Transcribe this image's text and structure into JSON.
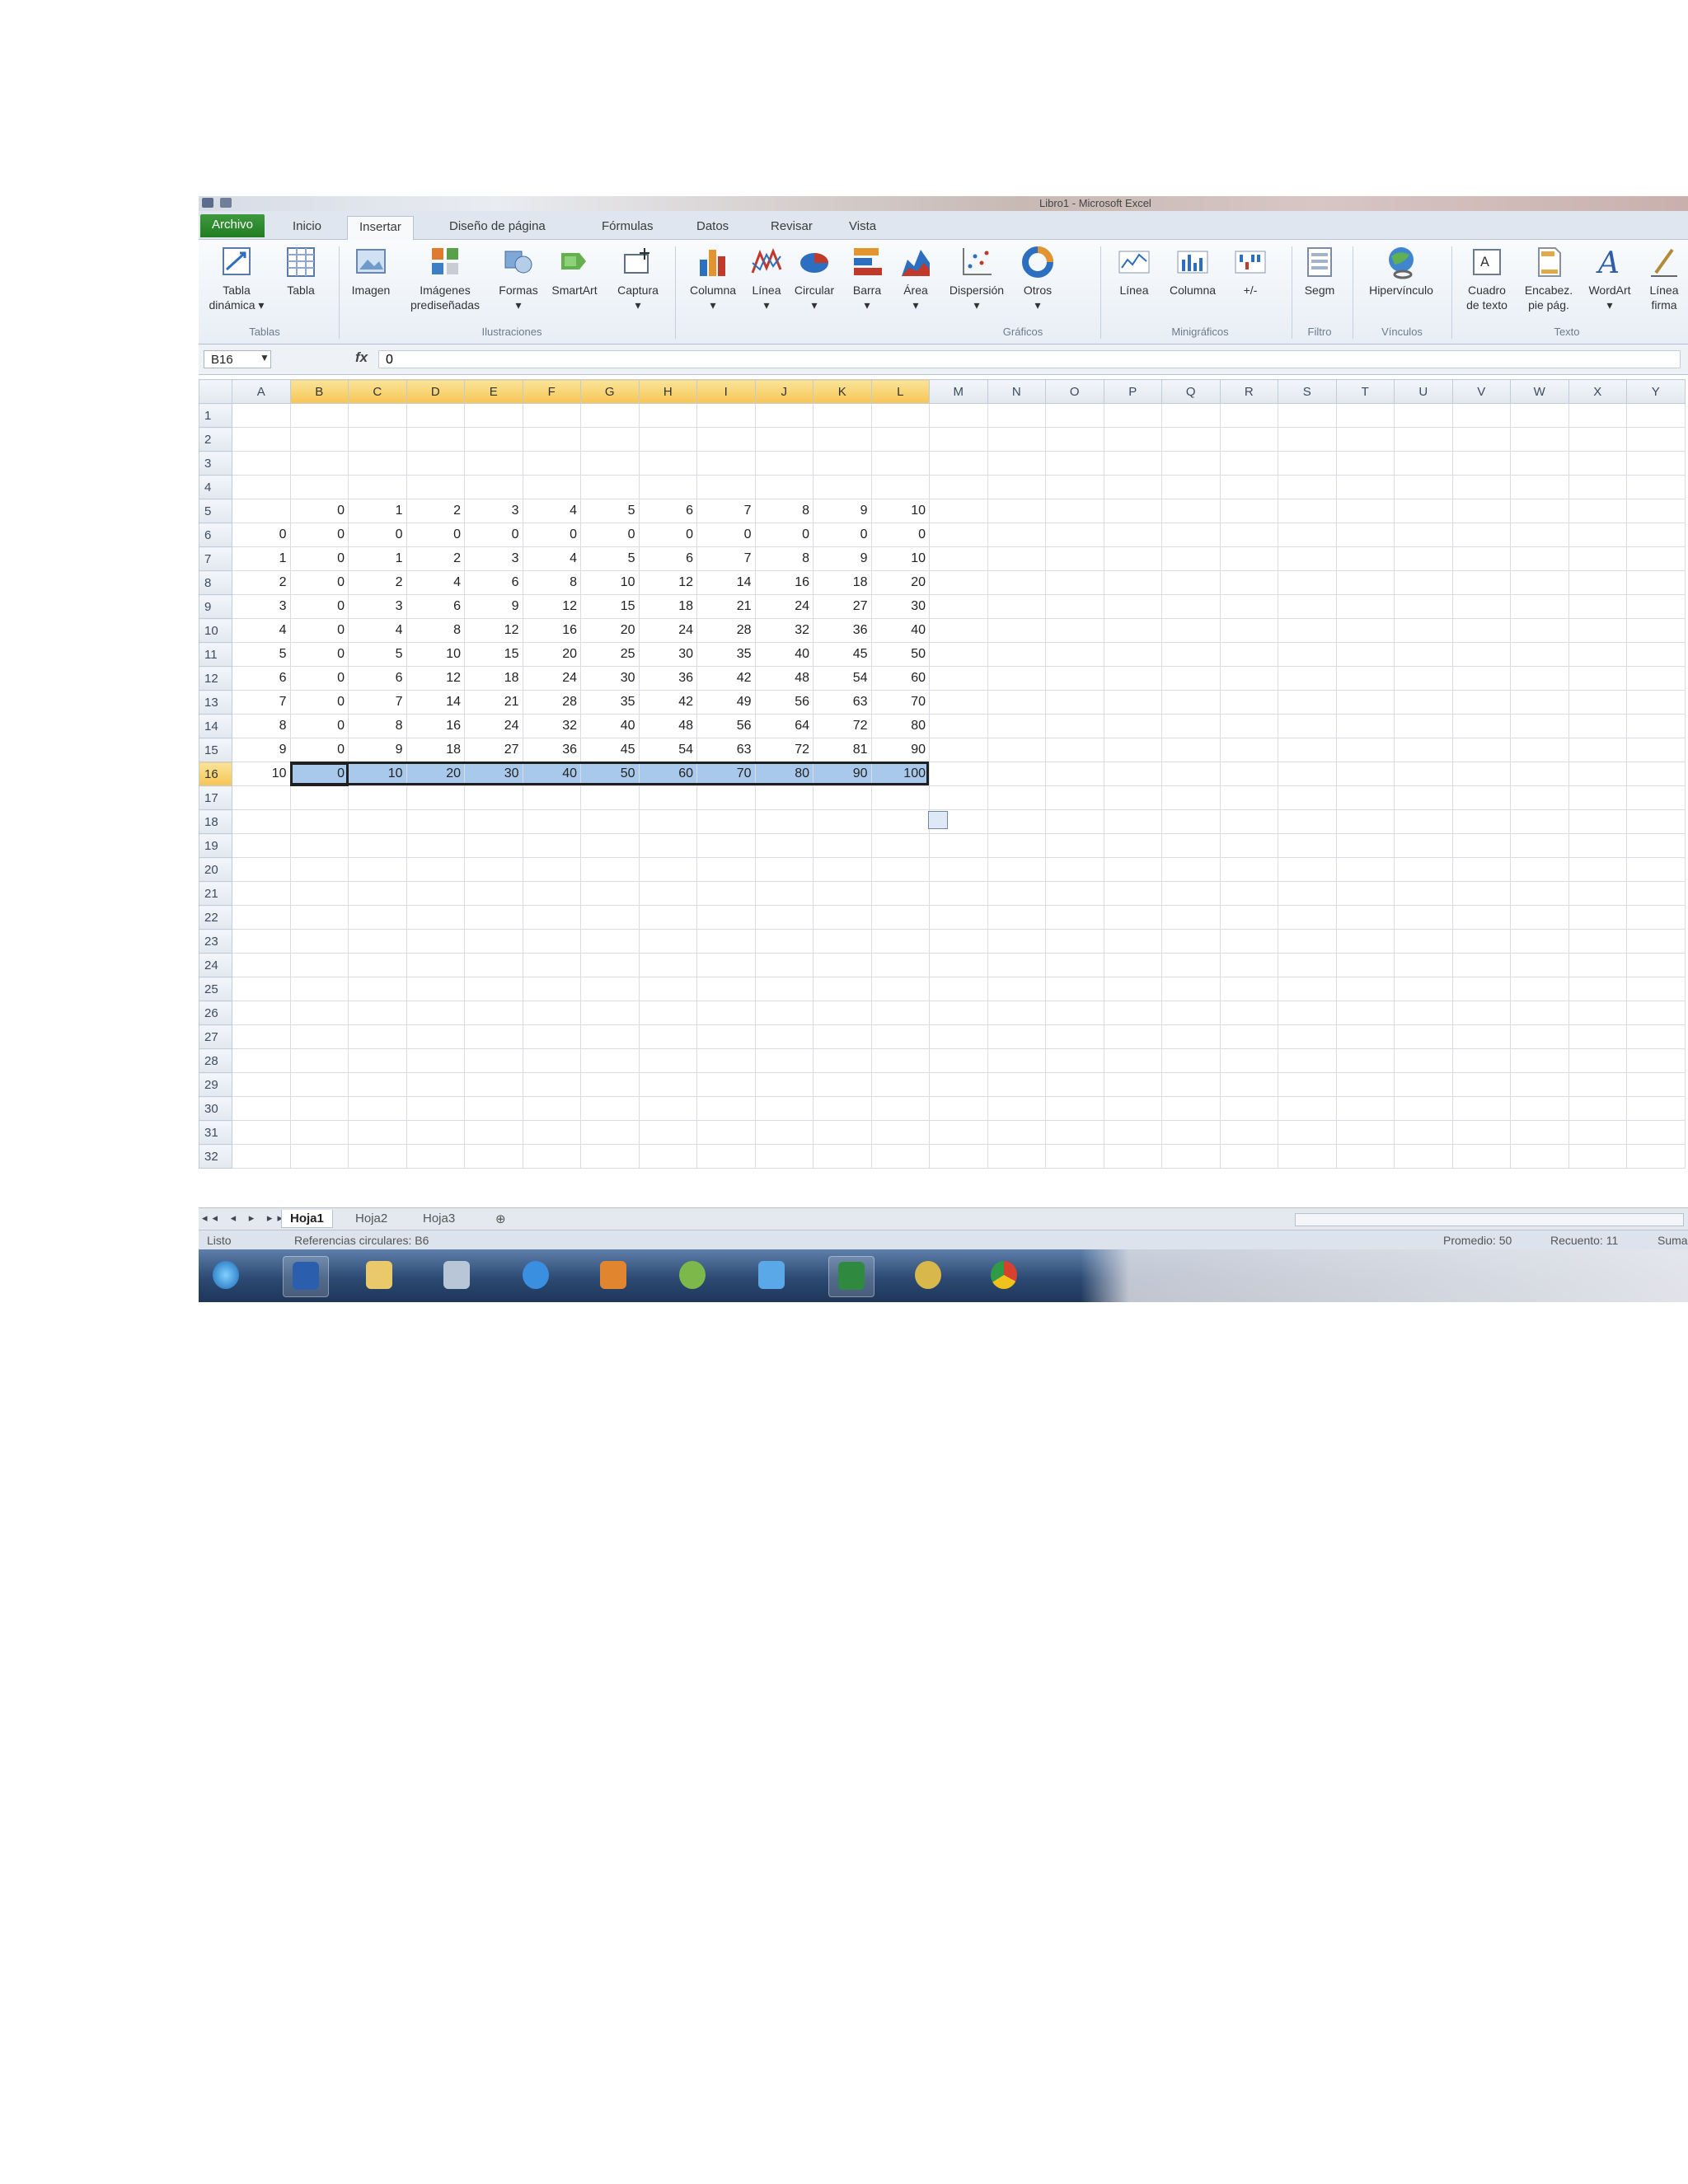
{
  "window": {
    "title": "Libro1 - Microsoft Excel"
  },
  "tabs": [
    "Archivo",
    "Inicio",
    "Insertar",
    "Diseño de página",
    "Fórmulas",
    "Datos",
    "Revisar",
    "Vista"
  ],
  "ribbon": {
    "buttons": {
      "tabla_dinamica": "Tabla\ndinámica ▾",
      "tabla": "Tabla",
      "imagen": "Imagen",
      "imagenes_pred": "Imágenes\nprediseñadas",
      "formas": "Formas\n▾",
      "smartart": "SmartArt",
      "captura": "Captura\n▾",
      "columna": "Columna\n▾",
      "linea": "Línea\n▾",
      "circular": "Circular\n▾",
      "barra": "Barra\n▾",
      "area": "Área\n▾",
      "dispersion": "Dispersión\n▾",
      "otros": "Otros\n▾",
      "mini_linea": "Línea",
      "mini_columna": "Columna",
      "mini_pm": "+/-",
      "segm": "Segm",
      "hipervinculo": "Hipervínculo",
      "cuadro_texto": "Cuadro\nde texto",
      "encabez": "Encabez.\npie pág.",
      "wordart": "WordArt\n▾",
      "linea_firma": "Línea\nfirma"
    },
    "groups": {
      "tablas": "Tablas",
      "ilustraciones": "Ilustraciones",
      "graficos": "Gráficos",
      "minigraficos": "Minigráficos",
      "filtro": "Filtro",
      "vinculos": "Vínculos",
      "texto": "Texto"
    }
  },
  "formula_bar": {
    "name_box": "B16",
    "fx": "fx",
    "value": "0"
  },
  "sheet": {
    "columns": [
      "A",
      "B",
      "C",
      "D",
      "E",
      "F",
      "G",
      "H",
      "I",
      "J",
      "K",
      "L",
      "M",
      "N",
      "O",
      "P",
      "Q",
      "R",
      "S",
      "T",
      "U",
      "V",
      "W",
      "X",
      "Y"
    ],
    "row_count": 32,
    "rows": {
      "5": [
        "",
        "0",
        "1",
        "2",
        "3",
        "4",
        "5",
        "6",
        "7",
        "8",
        "9",
        "10"
      ],
      "6": [
        "0",
        "0",
        "0",
        "0",
        "0",
        "0",
        "0",
        "0",
        "0",
        "0",
        "0",
        "0"
      ],
      "7": [
        "1",
        "0",
        "1",
        "2",
        "3",
        "4",
        "5",
        "6",
        "7",
        "8",
        "9",
        "10"
      ],
      "8": [
        "2",
        "0",
        "2",
        "4",
        "6",
        "8",
        "10",
        "12",
        "14",
        "16",
        "18",
        "20"
      ],
      "9": [
        "3",
        "0",
        "3",
        "6",
        "9",
        "12",
        "15",
        "18",
        "21",
        "24",
        "27",
        "30"
      ],
      "10": [
        "4",
        "0",
        "4",
        "8",
        "12",
        "16",
        "20",
        "24",
        "28",
        "32",
        "36",
        "40"
      ],
      "11": [
        "5",
        "0",
        "5",
        "10",
        "15",
        "20",
        "25",
        "30",
        "35",
        "40",
        "45",
        "50"
      ],
      "12": [
        "6",
        "0",
        "6",
        "12",
        "18",
        "24",
        "30",
        "36",
        "42",
        "48",
        "54",
        "60"
      ],
      "13": [
        "7",
        "0",
        "7",
        "14",
        "21",
        "28",
        "35",
        "42",
        "49",
        "56",
        "63",
        "70"
      ],
      "14": [
        "8",
        "0",
        "8",
        "16",
        "24",
        "32",
        "40",
        "48",
        "56",
        "64",
        "72",
        "80"
      ],
      "15": [
        "9",
        "0",
        "9",
        "18",
        "27",
        "36",
        "45",
        "54",
        "63",
        "72",
        "81",
        "90"
      ],
      "16": [
        "10",
        "0",
        "10",
        "20",
        "30",
        "40",
        "50",
        "60",
        "70",
        "80",
        "90",
        "100"
      ]
    },
    "selected_row": "16"
  },
  "sheet_tabs": [
    "Hoja1",
    "Hoja2",
    "Hoja3"
  ],
  "status": {
    "left": "Listo",
    "circular": "Referencias circulares: B6",
    "promedio": "Promedio: 50",
    "recuento": "Recuento: 11",
    "suma": "Suma"
  },
  "colors": {
    "file_tab": "#2a852a",
    "selection": "#a8c9ec",
    "header_selected": "#f6c655"
  }
}
